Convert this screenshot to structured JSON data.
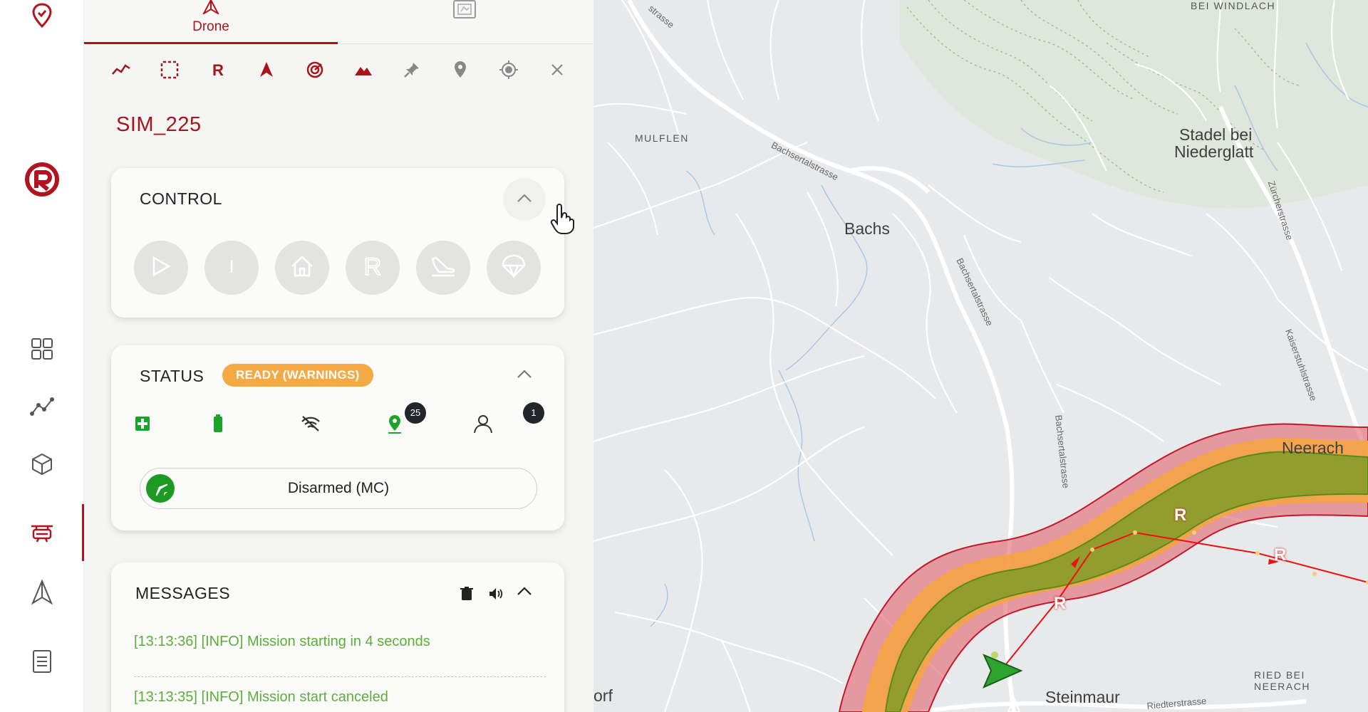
{
  "app": {
    "accent_color": "#b1141e",
    "left_nav": [
      {
        "name": "location-pin-icon"
      },
      {
        "name": "logo-icon"
      },
      {
        "name": "grid-icon"
      },
      {
        "name": "analytics-icon"
      },
      {
        "name": "cube-icon"
      },
      {
        "name": "drone-device-icon",
        "active": true
      },
      {
        "name": "navigation-arrow-icon"
      },
      {
        "name": "document-icon"
      }
    ]
  },
  "panel": {
    "tabs": [
      {
        "label": "Drone",
        "active": true
      },
      {
        "label": "",
        "icon": "map-frame-icon"
      }
    ],
    "toolbar": [
      "trajectory-icon",
      "selection-icon",
      "rally-point-icon",
      "arrow-icon",
      "radar-icon",
      "terrain-icon",
      "pin-icon",
      "marker-icon",
      "target-icon",
      "close-icon"
    ],
    "drone_name": "SIM_225",
    "control": {
      "title": "CONTROL",
      "buttons": [
        "play-icon",
        "pause-icon",
        "home-icon",
        "return-icon",
        "land-icon",
        "parachute-icon"
      ]
    },
    "status": {
      "title": "STATUS",
      "badge": "READY (WARNINGS)",
      "badge_color": "#f5a944",
      "gps_count": "25",
      "pilot_count": "1",
      "mode": "Disarmed (MC)"
    },
    "messages": {
      "title": "MESSAGES",
      "items": [
        "[13:13:36] [INFO] Mission starting in 4 seconds",
        "[13:13:35] [INFO] Mission start canceled"
      ]
    }
  },
  "map": {
    "labels": {
      "bei_windlach": "BEI WINDLACH",
      "mulflen": "MULFLEN",
      "stadel": "Stadel bei",
      "niederglatt": "Niederglatt",
      "bachs": "Bachs",
      "neerach": "Neerach",
      "ried_bei": "RIED BEI",
      "ried_neerach": "NEERACH",
      "steinmaur": "Steinmaur",
      "orf": "orf",
      "street_bachsertalstrasse1": "Bachsertalstrasse",
      "street_bachsertalstrasse2": "Bachsertalstrasse",
      "street_bachsertalstrasse3": "Bachsertalstrasse",
      "street_zurcherstrasse": "Zürcherstrasse",
      "street_kaiserstuhlstrasse": "Kaiserstuhlstrasse",
      "street_riedterstrasse": "Riedterstrasse",
      "street_strasse": "strasse"
    },
    "waypoint_label": "R",
    "zone_colors": {
      "outer": "#d9434f",
      "middle": "#f5a43a",
      "inner": "#6a9a1f"
    }
  }
}
